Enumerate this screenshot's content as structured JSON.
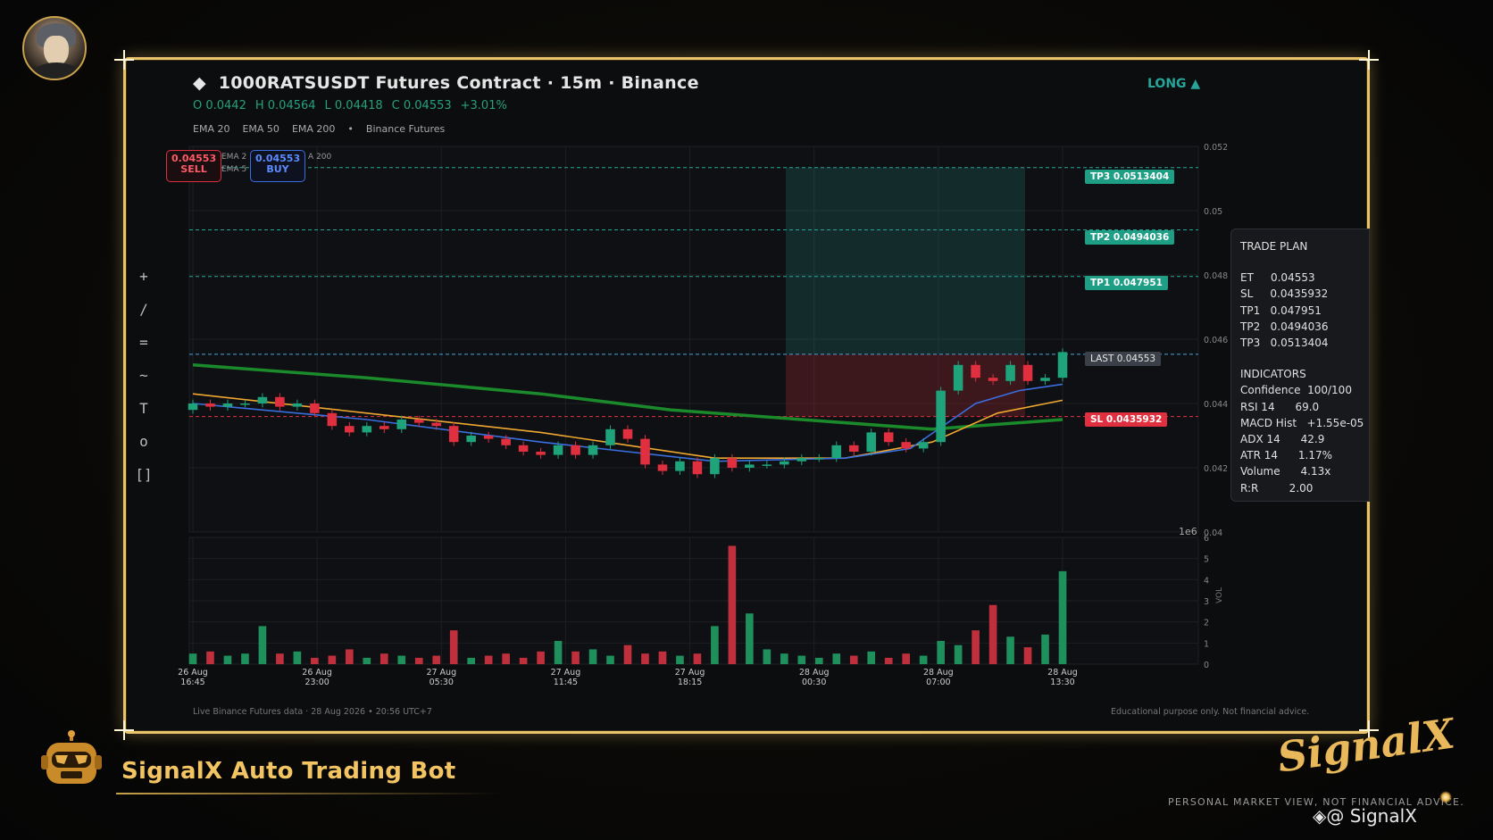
{
  "header": {
    "diamond": "◆",
    "title": "1000RATSUSDT Futures Contract  ·  15m  ·  Binance",
    "ohlc": [
      "O 0.0442",
      "H 0.04564",
      "L 0.04418",
      "C 0.04553",
      "+3.01%"
    ],
    "legend": [
      "EMA 20",
      "EMA 50",
      "EMA 200",
      "•",
      "Binance Futures"
    ],
    "direction": "LONG ▲"
  },
  "toolbar": [
    "+",
    "/",
    "=",
    "~",
    "T",
    "o",
    "[]"
  ],
  "order_buttons": {
    "sell_price": "0.04553",
    "sell_label": "SELL",
    "buy_price": "0.04553",
    "buy_label": "BUY",
    "overlay_ema": "EMA 2",
    "overlay_ema2": "EMA 5",
    "overlay_ema200": "A 200"
  },
  "levels": {
    "tp3": "TP3  0.0513404",
    "tp2": "TP2  0.0494036",
    "tp1": "TP1  0.047951",
    "last": "LAST  0.04553",
    "sl": "SL  0.0435932"
  },
  "trade_plan": {
    "title": "TRADE PLAN",
    "rows": [
      "ET     0.04553",
      "SL     0.0435932",
      "TP1   0.047951",
      "TP2   0.0494036",
      "TP3   0.0513404"
    ],
    "ind_title": "INDICATORS",
    "ind_rows": [
      "Confidence  100/100",
      "RSI 14      69.0",
      "MACD Hist   +1.55e-05",
      "ADX 14      42.9",
      "ATR 14      1.17%",
      "Volume      4.13x",
      "R:R         2.00"
    ]
  },
  "chart_data": {
    "type": "candlestick",
    "symbol": "1000RATSUSDT",
    "interval": "15m",
    "price_axis": {
      "ticks": [
        "0.052",
        "0.05",
        "0.048",
        "0.046",
        "0.044",
        "0.042",
        "0.04"
      ],
      "ylim": [
        0.04,
        0.052
      ],
      "label": "1e6"
    },
    "volume_axis": {
      "label": "VOL",
      "ticks": [
        "0",
        "1",
        "2",
        "3",
        "4",
        "5",
        "6"
      ],
      "ylim": [
        0,
        6
      ]
    },
    "x_ticks": [
      "26 Aug 16:45",
      "26 Aug 23:00",
      "27 Aug 05:30",
      "27 Aug 11:45",
      "27 Aug 18:15",
      "28 Aug 00:30",
      "28 Aug 07:00",
      "28 Aug 13:30"
    ],
    "levels": {
      "tp3": 0.0513404,
      "tp2": 0.0494036,
      "tp1": 0.047951,
      "entry": 0.04553,
      "sl": 0.0435932
    },
    "close_path": [
      0.044,
      0.0439,
      0.044,
      0.044,
      0.0442,
      0.0439,
      0.044,
      0.0437,
      0.0433,
      0.0431,
      0.0433,
      0.0432,
      0.0435,
      0.0434,
      0.0433,
      0.0428,
      0.043,
      0.0429,
      0.0427,
      0.0425,
      0.0424,
      0.0427,
      0.0424,
      0.0427,
      0.0432,
      0.0429,
      0.0421,
      0.0419,
      0.0422,
      0.0418,
      0.0423,
      0.042,
      0.0421,
      0.0421,
      0.0422,
      0.0423,
      0.0423,
      0.0427,
      0.0425,
      0.0431,
      0.0428,
      0.0426,
      0.0428,
      0.0444,
      0.0452,
      0.0448,
      0.0447,
      0.0452,
      0.0447,
      0.0448,
      0.0456
    ],
    "close_x": [
      0,
      4,
      8,
      12,
      16,
      20,
      24,
      28,
      32,
      36,
      40,
      44,
      48,
      52,
      56,
      60,
      64,
      68,
      72,
      76,
      80,
      84,
      88,
      92,
      96,
      100,
      104,
      108,
      112,
      116,
      120,
      124,
      128,
      132,
      136,
      140,
      144,
      148,
      152,
      156,
      160,
      164,
      168,
      172,
      176,
      180,
      184,
      188,
      192,
      196,
      200
    ],
    "ema20": [
      [
        0,
        0.044
      ],
      [
        40,
        0.0435
      ],
      [
        80,
        0.0428
      ],
      [
        100,
        0.0425
      ],
      [
        120,
        0.0422
      ],
      [
        150,
        0.0423
      ],
      [
        165,
        0.0426
      ],
      [
        180,
        0.044
      ],
      [
        190,
        0.0444
      ],
      [
        200,
        0.0446
      ]
    ],
    "ema50": [
      [
        0,
        0.0443
      ],
      [
        40,
        0.0437
      ],
      [
        80,
        0.0431
      ],
      [
        100,
        0.0427
      ],
      [
        120,
        0.0423
      ],
      [
        150,
        0.0423
      ],
      [
        170,
        0.0428
      ],
      [
        185,
        0.0437
      ],
      [
        200,
        0.0441
      ]
    ],
    "ema200": [
      [
        0,
        0.0452
      ],
      [
        40,
        0.0448
      ],
      [
        80,
        0.0443
      ],
      [
        110,
        0.0438
      ],
      [
        140,
        0.0435
      ],
      [
        170,
        0.0432
      ],
      [
        200,
        0.0435
      ]
    ],
    "volume": [
      0.5,
      0.6,
      0.4,
      0.5,
      1.8,
      0.5,
      0.6,
      0.3,
      0.4,
      0.7,
      0.3,
      0.5,
      0.4,
      0.3,
      0.4,
      1.6,
      0.3,
      0.4,
      0.5,
      0.3,
      0.6,
      1.1,
      0.6,
      0.7,
      0.4,
      0.9,
      0.5,
      0.6,
      0.4,
      0.5,
      1.8,
      5.6,
      2.4,
      0.7,
      0.5,
      0.4,
      0.3,
      0.5,
      0.4,
      0.6,
      0.3,
      0.5,
      0.4,
      1.1,
      0.9,
      1.6,
      2.8,
      1.3,
      0.8,
      1.4,
      4.4
    ]
  },
  "footer": {
    "left": "Live Binance Futures data   ·   28 Aug 2026  •  20:56 UTC+7",
    "right": "Educational purpose only. Not financial advice."
  },
  "branding": {
    "bot": "SignalX Auto Trading Bot",
    "logo": "SignalX",
    "disclaimer": "PERSONAL MARKET VIEW, NOT FINANCIAL ADVICE.",
    "handle": "◈@ SignalX"
  }
}
